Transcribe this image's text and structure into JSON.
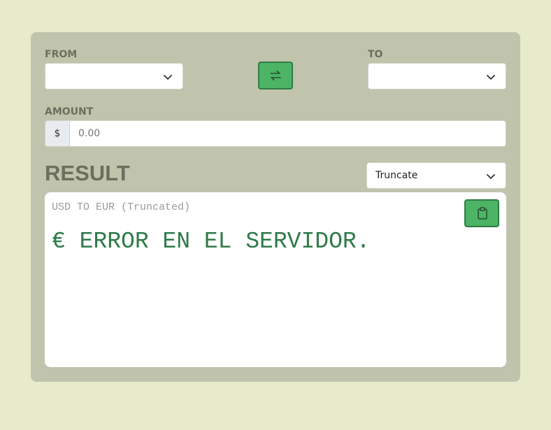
{
  "from": {
    "label": "FROM",
    "selected": ""
  },
  "to": {
    "label": "TO",
    "selected": ""
  },
  "swap": {
    "icon": "swap-arrows-icon"
  },
  "amount": {
    "label": "AMOUNT",
    "prefix": "$",
    "placeholder": "0.00",
    "value": ""
  },
  "result": {
    "title": "RESULT",
    "mode_selected": "Truncate",
    "subtitle": "USD TO EUR (Truncated)",
    "value": "€ ERROR EN EL SERVIDOR.",
    "copy_icon": "clipboard-icon"
  },
  "colors": {
    "page_bg": "#e7ebcb",
    "card_bg": "#c0c4ac",
    "accent_button": "#4cb464",
    "accent_border": "#2e7d45",
    "label_text": "#6b6f5e",
    "result_text": "#2f7a4a"
  }
}
